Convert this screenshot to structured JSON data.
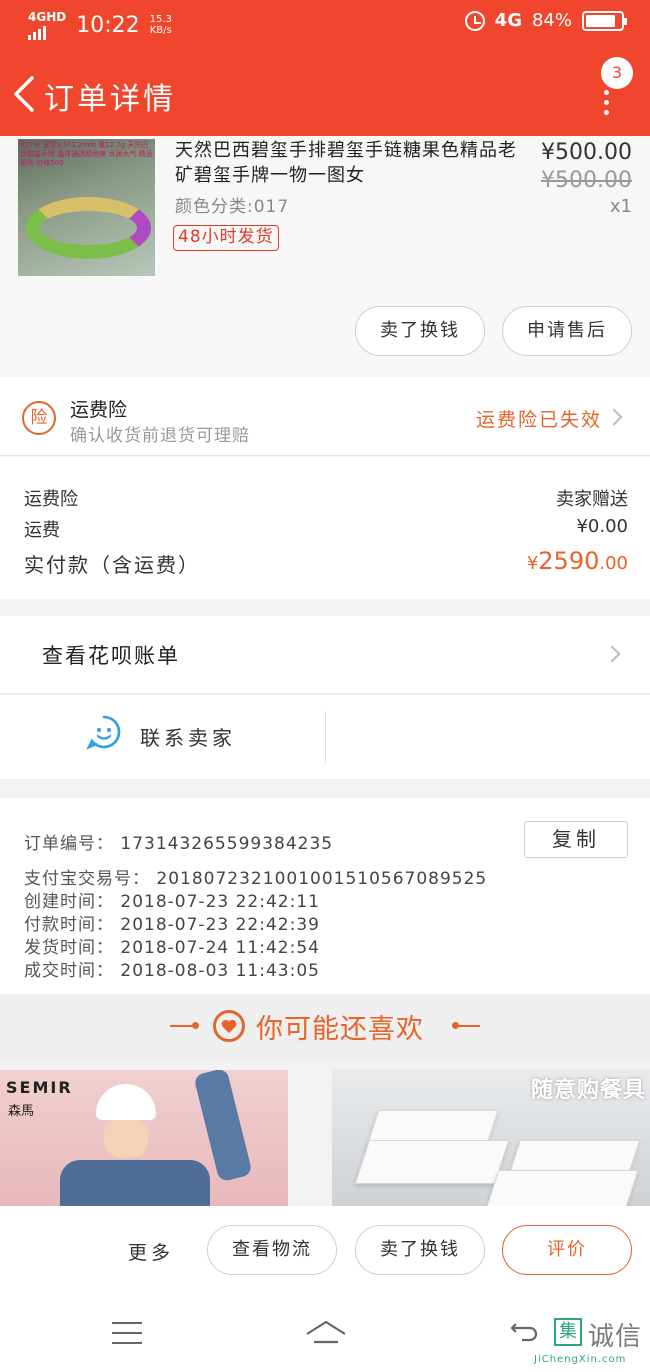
{
  "status_bar": {
    "network": "4GHD",
    "time": "10:22",
    "speed_value": "15.3",
    "speed_unit": "KB/s",
    "network_type": "4G",
    "battery": "84%"
  },
  "nav": {
    "title": "订单详情",
    "badge_count": "3"
  },
  "product": {
    "thumb_text": "017号 宽厚9.5*3.2mm 重12.7g 天然巴西碧玺手牌 晶体通透颜色美 水润大气 精品级别 价格500",
    "title": "天然巴西碧玺手排碧玺手链糖果色精品老矿碧玺手牌一物一图女",
    "spec": "颜色分类:017",
    "tag": "48小时发货",
    "price": "¥500.00",
    "original_price": "¥500.00",
    "quantity": "x1",
    "btn_resell": "卖了换钱",
    "btn_aftersale": "申请售后"
  },
  "insurance": {
    "icon_text": "险",
    "title": "运费险",
    "subtitle": "确认收货前退货可理赔",
    "status": "运费险已失效"
  },
  "fees": {
    "insurance_label": "运费险",
    "insurance_value": "卖家赠送",
    "shipping_label": "运费",
    "shipping_value": "¥0.00",
    "paid_label": "实付款（含运费）",
    "paid_currency": "¥",
    "paid_main": "2590",
    "paid_decimal": ".00"
  },
  "huabei": {
    "label": "查看花呗账单"
  },
  "contact": {
    "label": "联系卖家"
  },
  "order_info": {
    "order_no_label": "订单编号：",
    "order_no": "173143265599384235",
    "copy_label": "复制",
    "alipay_label": "支付宝交易号：",
    "alipay_no": "2018072321001001510567089525",
    "created_label": "创建时间：",
    "created": "2018-07-23 22:42:11",
    "paid_label": "付款时间：",
    "paid": "2018-07-23 22:42:39",
    "shipped_label": "发货时间：",
    "shipped": "2018-07-24 11:42:54",
    "completed_label": "成交时间：",
    "completed": "2018-08-03 11:43:05"
  },
  "recommend": {
    "title": "你可能还喜欢",
    "item1_brand": "SEMIR",
    "item1_brand_cn": "森馬",
    "item2_caption": "随意购餐具"
  },
  "action_bar": {
    "more": "更多",
    "logistics": "查看物流",
    "resell": "卖了换钱",
    "review": "评价"
  },
  "watermark": {
    "box": "集",
    "cn": "诚信",
    "url": "JiChengXin.com"
  },
  "colors": {
    "header_bg": "#f0462d",
    "accent": "#e8632a",
    "tag_red": "#e03a2a"
  }
}
